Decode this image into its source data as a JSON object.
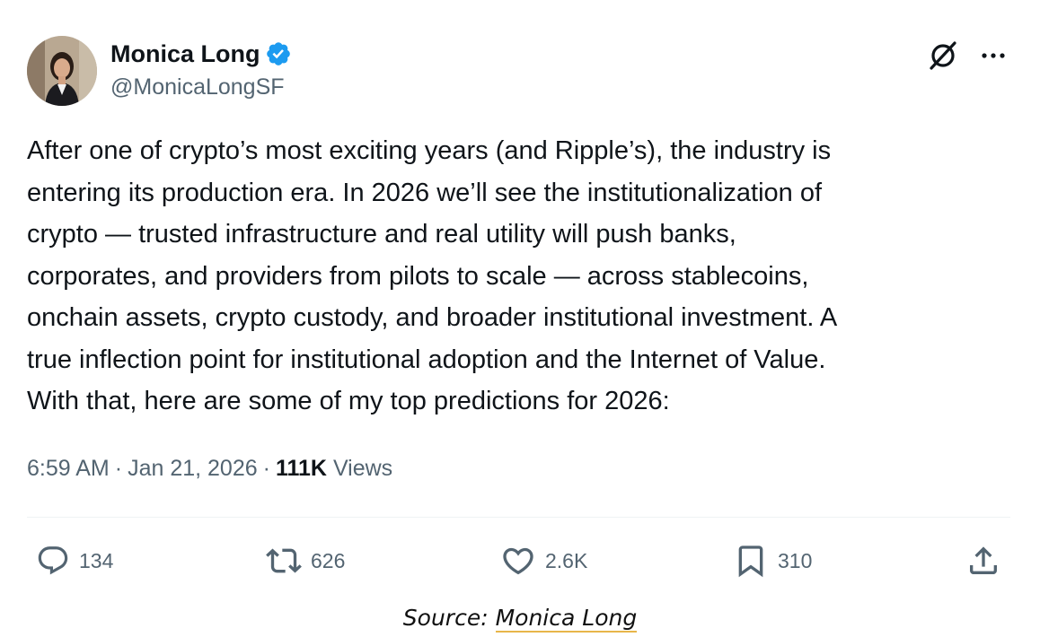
{
  "author": {
    "display_name": "Monica Long",
    "handle": "@MonicaLongSF",
    "verified": true
  },
  "tweet": {
    "lines": [
      "After one of crypto’s most exciting years (and Ripple’s), the industry is",
      "entering its production era. In 2026 we’ll see the institutionalization of",
      "crypto — trusted infrastructure and real utility will push banks,",
      "corporates, and providers from pilots to scale — across stablecoins,",
      "onchain assets, crypto custody, and broader institutional investment. A",
      "true inflection point for institutional adoption and the Internet of Value.",
      "With that, here are some of my top predictions for 2026:"
    ]
  },
  "meta": {
    "time": "6:59 AM",
    "date": "Jan 21, 2026",
    "separator": "·",
    "views_count": "111K",
    "views_label": "Views"
  },
  "actions": {
    "replies": "134",
    "reposts": "626",
    "likes": "2.6K",
    "bookmarks": "310"
  },
  "icons": {
    "verified": "verified-badge-icon",
    "grok": "grok-icon",
    "more": "more-options-icon",
    "reply": "reply-icon",
    "repost": "repost-icon",
    "like": "heart-icon",
    "bookmark": "bookmark-icon",
    "share": "share-icon"
  },
  "colors": {
    "text_primary": "#0f1419",
    "text_secondary": "#536471",
    "verified_blue": "#1d9bf0",
    "divider": "#eff3f4",
    "source_underline": "#e8b64a"
  },
  "source": {
    "prefix": "Source:",
    "link_text": "Monica Long"
  }
}
